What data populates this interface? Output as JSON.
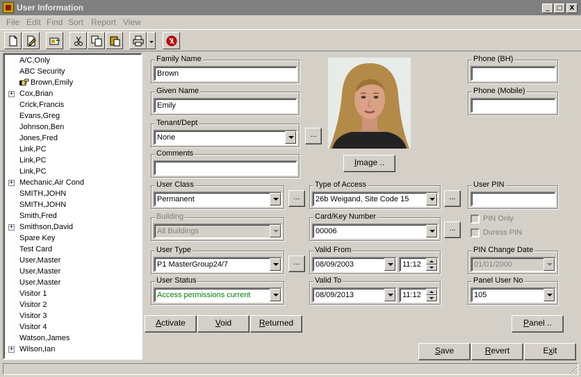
{
  "window": {
    "title": "User Information",
    "controls": {
      "minimize": "_",
      "maximize": "□",
      "close": "X"
    }
  },
  "menu": [
    "File",
    "Edit",
    "Find",
    "Sort",
    "Report",
    "View"
  ],
  "toolbar": {
    "buttons": [
      "new-icon",
      "edit-icon",
      "open-card-icon",
      "cut-icon",
      "copy-icon",
      "paste-icon",
      "print-icon",
      "dropdown-arrow-icon",
      "stop-icon"
    ]
  },
  "tree": {
    "items": [
      {
        "label": "A/C,Only",
        "expandable": false
      },
      {
        "label": "ABC Security",
        "expandable": false
      },
      {
        "label": "Brown,Emily",
        "expandable": false,
        "selected": true
      },
      {
        "label": "Cox,Brian",
        "expandable": true
      },
      {
        "label": "Crick,Francis",
        "expandable": false
      },
      {
        "label": "Evans,Greg",
        "expandable": false
      },
      {
        "label": "Johnson,Ben",
        "expandable": false
      },
      {
        "label": "Jones,Fred",
        "expandable": false
      },
      {
        "label": "Link,PC",
        "expandable": false
      },
      {
        "label": "Link,PC",
        "expandable": false
      },
      {
        "label": "Link,PC",
        "expandable": false
      },
      {
        "label": "Mechanic,Air Cond",
        "expandable": true
      },
      {
        "label": "SMITH,JOHN",
        "expandable": false
      },
      {
        "label": "SMITH,JOHN",
        "expandable": false
      },
      {
        "label": "Smith,Fred",
        "expandable": false
      },
      {
        "label": "Smithson,David",
        "expandable": true
      },
      {
        "label": "Spare Key",
        "expandable": false
      },
      {
        "label": "Test Card",
        "expandable": false
      },
      {
        "label": "User,Master",
        "expandable": false
      },
      {
        "label": "User,Master",
        "expandable": false
      },
      {
        "label": "User,Master",
        "expandable": false
      },
      {
        "label": "Visitor 1",
        "expandable": false
      },
      {
        "label": "Visitor 2",
        "expandable": false
      },
      {
        "label": "Visitor 3",
        "expandable": false
      },
      {
        "label": "Visitor 4",
        "expandable": false
      },
      {
        "label": "Watson,James",
        "expandable": false
      },
      {
        "label": "Wilson,Ian",
        "expandable": true
      }
    ],
    "expander_glyph": "+"
  },
  "form": {
    "family_name": {
      "label": "Family Name",
      "value": "Brown"
    },
    "given_name": {
      "label": "Given Name",
      "value": "Emily"
    },
    "tenant_dept": {
      "label": "Tenant/Dept",
      "value": "None"
    },
    "comments": {
      "label": "Comments",
      "value": ""
    },
    "phone_bh": {
      "label": "Phone (BH)",
      "value": ""
    },
    "phone_mobile": {
      "label": "Phone (Mobile)",
      "value": ""
    },
    "user_class": {
      "label": "User Class",
      "value": "Permanent"
    },
    "type_of_access": {
      "label": "Type of Access",
      "value": "26b Weigand, Site Code 15"
    },
    "user_pin": {
      "label": "User PIN",
      "value": ""
    },
    "building": {
      "label": "Building",
      "value": "All Buildings"
    },
    "card_key": {
      "label": "Card/Key Number",
      "value": "00006"
    },
    "pin_only": {
      "label": "PIN Only",
      "checked": false
    },
    "duress_pin": {
      "label": "Duress PIN",
      "checked": false
    },
    "user_type": {
      "label": "User Type",
      "value": "P1 MasterGroup24/7"
    },
    "valid_from": {
      "label": "Valid From",
      "date": "08/09/2003",
      "time": "11:12"
    },
    "pin_change_date": {
      "label": "PIN Change Date",
      "value": "01/01/2000"
    },
    "user_status": {
      "label": "User Status",
      "value": "Access permissions current",
      "color": "#008000"
    },
    "valid_to": {
      "label": "Valid To",
      "date": "08/09/2013",
      "time": "11:12"
    },
    "panel_user_no": {
      "label": "Panel User No",
      "value": "105"
    },
    "ellipsis": "..."
  },
  "buttons": {
    "image": {
      "pre": "",
      "key": "I",
      "post": "mage .."
    },
    "activate": {
      "pre": "",
      "key": "A",
      "post": "ctivate"
    },
    "void": {
      "pre": "",
      "key": "V",
      "post": "oid"
    },
    "returned": {
      "pre": "",
      "key": "R",
      "post": "eturned"
    },
    "panel": {
      "pre": "",
      "key": "P",
      "post": "anel .."
    },
    "save": {
      "pre": "",
      "key": "S",
      "post": "ave"
    },
    "revert": {
      "pre": "",
      "key": "R",
      "post": "evert"
    },
    "exit": {
      "pre": "E",
      "key": "x",
      "post": "it"
    }
  }
}
